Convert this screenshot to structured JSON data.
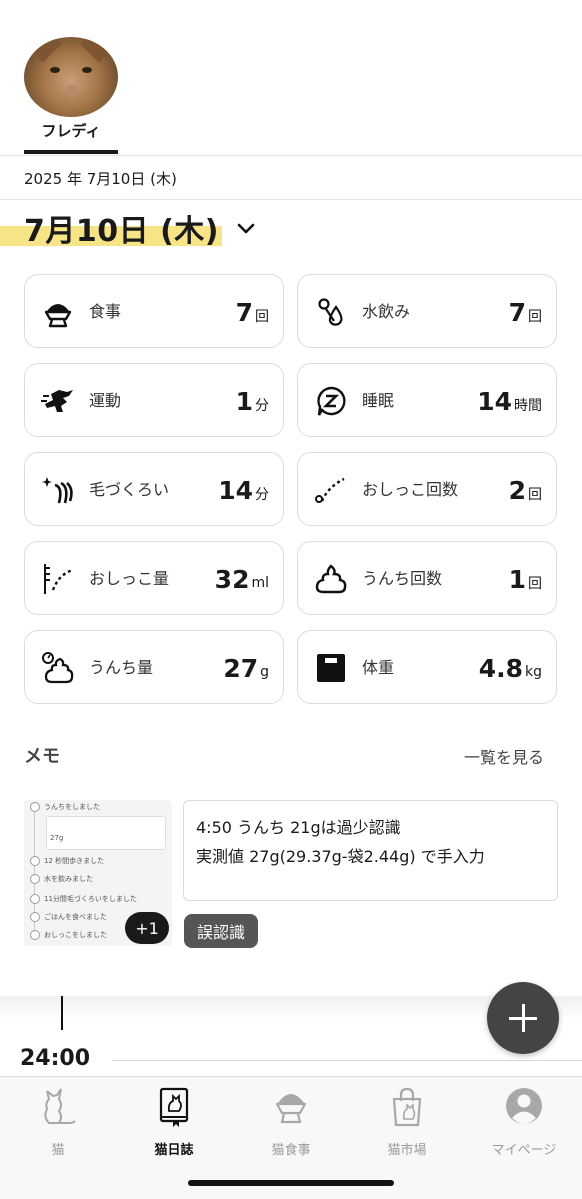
{
  "pet": {
    "name": "フレディ"
  },
  "date": {
    "small": "2025 年 7月10日 (木)",
    "large": "7月10日 (木)"
  },
  "stats": [
    {
      "icon": "food-bowl-icon",
      "label": "食事",
      "value": "7",
      "unit": "回"
    },
    {
      "icon": "water-drop-icon",
      "label": "水飲み",
      "value": "7",
      "unit": "回"
    },
    {
      "icon": "running-cat-icon",
      "label": "運動",
      "value": "1",
      "unit": "分"
    },
    {
      "icon": "sleep-z-icon",
      "label": "睡眠",
      "value": "14",
      "unit": "時間"
    },
    {
      "icon": "grooming-icon",
      "label": "毛づくろい",
      "value": "14",
      "unit": "分"
    },
    {
      "icon": "pee-drops-icon",
      "label": "おしっこ回数",
      "value": "2",
      "unit": "回"
    },
    {
      "icon": "pee-amount-icon",
      "label": "おしっこ量",
      "value": "32",
      "unit": "ml"
    },
    {
      "icon": "poop-icon",
      "label": "うんち回数",
      "value": "1",
      "unit": "回"
    },
    {
      "icon": "poop-amount-icon",
      "label": "うんち量",
      "value": "27",
      "unit": "g"
    },
    {
      "icon": "scale-icon",
      "label": "体重",
      "value": "4.8",
      "unit": "kg"
    }
  ],
  "memo": {
    "title": "メモ",
    "see_all": "一覧を見る",
    "text_line1": "4:50 うんち 21gは過少認識",
    "text_line2": "実測値 27g(29.37g-袋2.44g) で手入力",
    "extra_count": "+1",
    "tag": "誤認識",
    "thumb_rows": [
      "うんちをしました",
      "27g",
      "12 秒間歩きました",
      "水を飲みました",
      "11分間毛づくろいをしました",
      "ごはんを食べました",
      "おしっこをしました"
    ]
  },
  "timeline": {
    "time": "24:00"
  },
  "tabs": [
    {
      "icon": "cat-icon",
      "label": "猫"
    },
    {
      "icon": "cat-diary-icon",
      "label": "猫日誌"
    },
    {
      "icon": "cat-food-icon",
      "label": "猫食事"
    },
    {
      "icon": "shopping-bag-icon",
      "label": "猫市場"
    },
    {
      "icon": "user-profile-icon",
      "label": "マイページ"
    }
  ]
}
